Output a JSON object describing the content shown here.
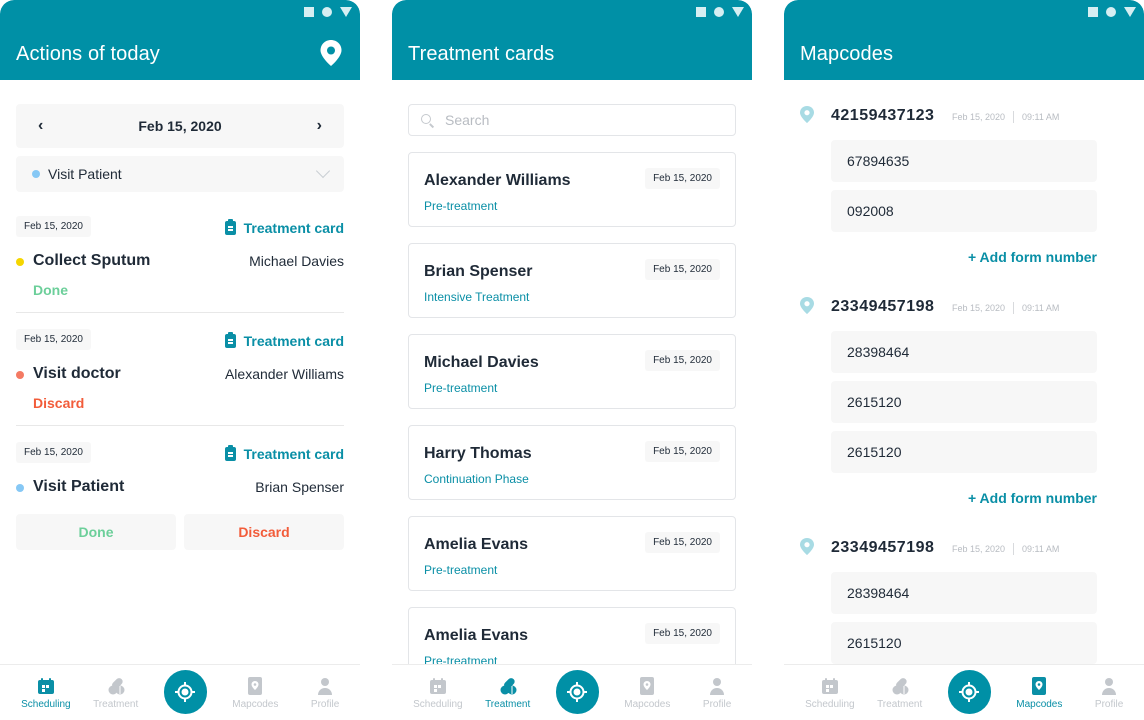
{
  "colors": {
    "primary": "#0090a6",
    "link": "#0a8fa6",
    "done": "#6ccf9a",
    "discard": "#f25c3a",
    "dot_yellow": "#f5d600",
    "dot_red": "#f47a63",
    "dot_blue": "#86c8f5",
    "inactive": "#c3c7cc"
  },
  "status_bar_icons": [
    "square-icon",
    "circle-icon",
    "triangle-icon"
  ],
  "screens": [
    {
      "title": "Actions of today",
      "action_icon": "location-pin-icon",
      "date_nav": {
        "prev": "‹",
        "date": "Feb 15, 2020",
        "next": "›"
      },
      "filter": {
        "selected": "Visit Patient"
      },
      "actions": [
        {
          "date": "Feb 15, 2020",
          "link": "Treatment card",
          "title": "Collect Sputum",
          "person": "Michael Davies",
          "status": "Done",
          "dot": "yellow"
        },
        {
          "date": "Feb 15, 2020",
          "link": "Treatment card",
          "title": "Visit doctor",
          "person": "Alexander Williams",
          "status": "Discard",
          "dot": "red"
        },
        {
          "date": "Feb 15, 2020",
          "link": "Treatment card",
          "title": "Visit Patient",
          "person": "Brian Spenser",
          "status": "",
          "dot": "blue"
        }
      ],
      "buttons": {
        "done": "Done",
        "discard": "Discard"
      },
      "active_tab": "Scheduling"
    },
    {
      "title": "Treatment cards",
      "search": {
        "placeholder": "Search",
        "value": ""
      },
      "cards": [
        {
          "name": "Alexander Williams",
          "phase": "Pre-treatment",
          "date": "Feb 15, 2020"
        },
        {
          "name": "Brian Spenser",
          "phase": "Intensive Treatment",
          "date": "Feb 15, 2020"
        },
        {
          "name": "Michael Davies",
          "phase": "Pre-treatment",
          "date": "Feb 15, 2020"
        },
        {
          "name": "Harry Thomas",
          "phase": "Continuation Phase",
          "date": "Feb 15, 2020"
        },
        {
          "name": "Amelia Evans",
          "phase": "Pre-treatment",
          "date": "Feb 15, 2020"
        },
        {
          "name": "Amelia Evans",
          "phase": "Pre-treatment",
          "date": "Feb 15, 2020"
        }
      ],
      "active_tab": "Treatment"
    },
    {
      "title": "Mapcodes",
      "mapcodes": [
        {
          "code": "42159437123",
          "date": "Feb 15, 2020",
          "time": "09:11 AM",
          "forms": [
            "67894635",
            "092008"
          ],
          "add_label": "+ Add form number"
        },
        {
          "code": "23349457198",
          "date": "Feb 15, 2020",
          "time": "09:11 AM",
          "forms": [
            "28398464",
            "2615120",
            "2615120"
          ],
          "add_label": "+ Add form number"
        },
        {
          "code": "23349457198",
          "date": "Feb 15, 2020",
          "time": "09:11 AM",
          "forms": [
            "28398464",
            "2615120"
          ],
          "add_label": ""
        }
      ],
      "active_tab": "Mapcodes"
    }
  ],
  "bottom_nav": {
    "items": [
      {
        "label": "Scheduling",
        "icon": "calendar-icon"
      },
      {
        "label": "Treatment",
        "icon": "pills-icon"
      },
      {
        "label": "Mapcodes",
        "icon": "map-pin-card-icon"
      },
      {
        "label": "Profile",
        "icon": "user-icon"
      }
    ],
    "center_icon": "locate-target-icon"
  }
}
